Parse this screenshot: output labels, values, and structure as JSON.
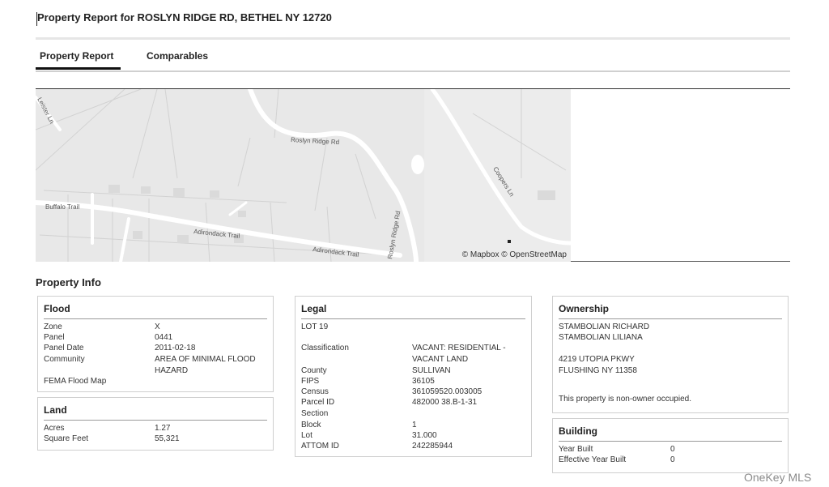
{
  "report": {
    "title": "Property Report for ROSLYN RIDGE RD, BETHEL NY 12720"
  },
  "tabs": [
    {
      "label": "Property Report"
    },
    {
      "label": "Comparables"
    }
  ],
  "map": {
    "attribution": "© Mapbox © OpenStreetMap",
    "streets": [
      "Roslyn Ridge Rd",
      "Buffalo Trail",
      "Adirondack Trail",
      "Adirondack Trail",
      "Roslyn Ridge Rd",
      "Coopers Ln",
      "Leister Ln"
    ]
  },
  "property_info": {
    "title": "Property Info"
  },
  "flood": {
    "title": "Flood",
    "rows": [
      {
        "label": "Zone",
        "value": "X"
      },
      {
        "label": "Panel",
        "value": "0441"
      },
      {
        "label": "Panel Date",
        "value": "2011-02-18"
      },
      {
        "label": "Community",
        "value": "AREA OF MINIMAL FLOOD",
        "value2": "HAZARD"
      }
    ],
    "fema_label": "FEMA Flood Map"
  },
  "land": {
    "title": "Land",
    "rows": [
      {
        "label": "Acres",
        "value": "1.27"
      },
      {
        "label": "Square Feet",
        "value": "55,321"
      }
    ]
  },
  "legal": {
    "title": "Legal",
    "lot_line": "LOT 19",
    "rows": [
      {
        "label": "Classification",
        "value": "VACANT: RESIDENTIAL -",
        "value2": "VACANT LAND"
      },
      {
        "label": "County",
        "value": "SULLIVAN"
      },
      {
        "label": "FIPS",
        "value": "36105"
      },
      {
        "label": "Census",
        "value": "361059520.003005"
      },
      {
        "label": "Parcel ID",
        "value": "482000 38.B-1-31"
      },
      {
        "label": "Section",
        "value": ""
      },
      {
        "label": "Block",
        "value": "1"
      },
      {
        "label": "Lot",
        "value": "31.000"
      },
      {
        "label": "ATTOM ID",
        "value": "242285944"
      }
    ]
  },
  "ownership": {
    "title": "Ownership",
    "owners": [
      "STAMBOLIAN RICHARD",
      "STAMBOLIAN LILIANA"
    ],
    "address": [
      "4219 UTOPIA PKWY",
      "FLUSHING NY 11358"
    ],
    "occupancy": "This property is non-owner occupied."
  },
  "building": {
    "title": "Building",
    "rows": [
      {
        "label": "Year Built",
        "value": "0"
      },
      {
        "label": "Effective Year Built",
        "value": "0"
      }
    ]
  },
  "watermark": "OneKey MLS"
}
